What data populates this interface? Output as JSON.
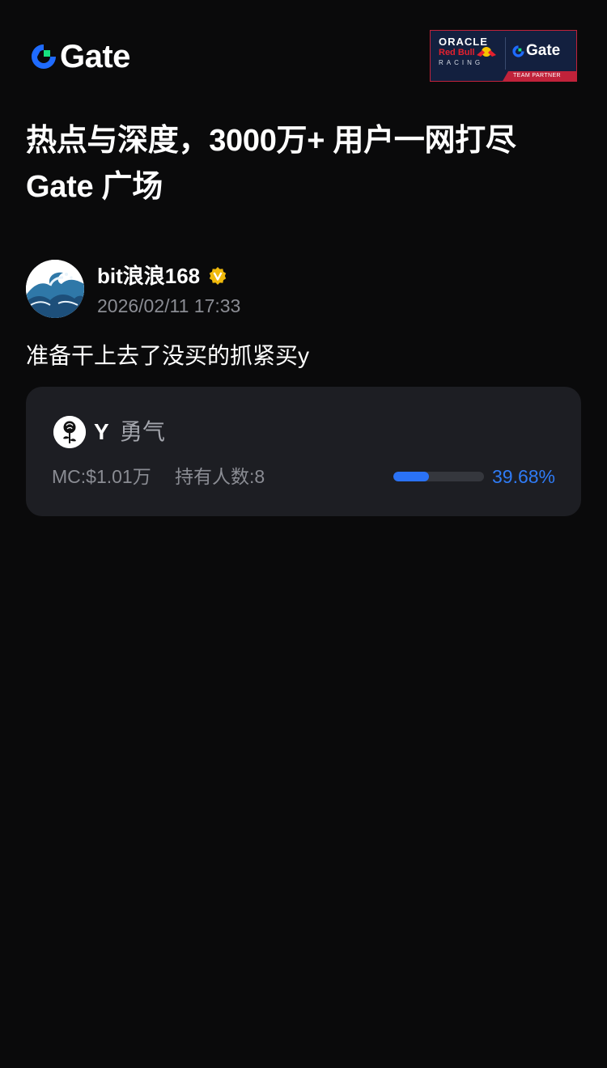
{
  "header": {
    "logo_text": "Gate",
    "partner": {
      "line1": "ORACLE",
      "line2": "Red Bull",
      "line3": "RACING",
      "gate_text": "Gate",
      "strip_text": "TEAM PARTNER"
    }
  },
  "headline": {
    "line1": "热点与深度，3000万+ 用户一网打尽",
    "line2": "Gate 广场"
  },
  "post": {
    "author_name": "bit浪浪168",
    "timestamp": "2026/02/11 17:33",
    "body": "准备干上去了没买的抓紧买y",
    "verified_icon": "verified-badge-icon",
    "avatar_icon": "wave-avatar"
  },
  "token_card": {
    "symbol": "Y",
    "name": "勇气",
    "market_cap": "MC:$1.01万",
    "holders": "持有人数:8",
    "progress_label": "39.68%",
    "progress_value": 0.3968,
    "icon": "rose-icon"
  },
  "colors": {
    "background": "#0a0a0b",
    "card": "#1d1e23",
    "accent_blue": "#2f7bf5",
    "verified_gold": "#f0b90b",
    "muted_text": "#8a8c93",
    "gate_blue": "#1f6bff",
    "gate_green": "#17e27f",
    "partner_navy": "#13203f",
    "partner_red": "#c0223a"
  }
}
